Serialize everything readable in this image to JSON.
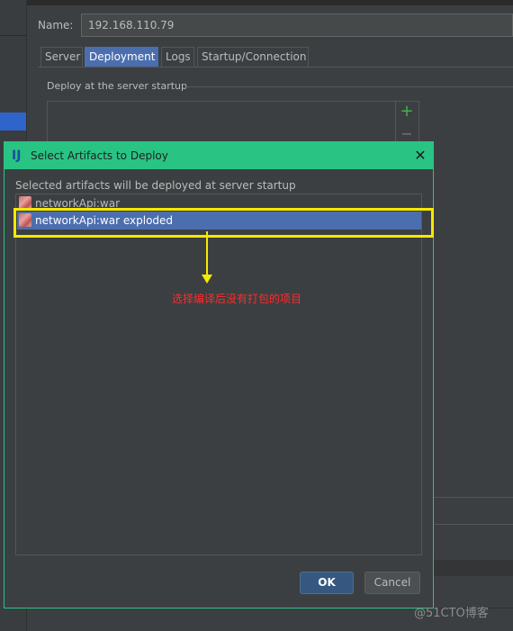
{
  "server": {
    "name_label": "Name:",
    "name_value": "192.168.110.79",
    "tabs": [
      {
        "label": "Server",
        "active": false
      },
      {
        "label": "Deployment",
        "active": true
      },
      {
        "label": "Logs",
        "active": false
      },
      {
        "label": "Startup/Connection",
        "active": false
      }
    ],
    "group_label": "Deploy at the server startup",
    "add_icon": "+",
    "remove_icon": "−"
  },
  "dialog": {
    "title": "Select Artifacts to Deploy",
    "app_icon": "IJ",
    "close_icon": "✕",
    "description": "Selected artifacts will be deployed at server startup",
    "artifacts": [
      {
        "label": "networkApi:war",
        "selected": false
      },
      {
        "label": "networkApi:war exploded",
        "selected": true
      }
    ],
    "ok_label": "OK",
    "cancel_label": "Cancel",
    "annotation": "选择编译后没有打包的项目"
  },
  "watermark": "@51CTO博客",
  "colors": {
    "titlebar": "#29c484",
    "selection": "#4b6eaf",
    "highlight": "#f5e900",
    "annotation": "#ff2b2b"
  }
}
